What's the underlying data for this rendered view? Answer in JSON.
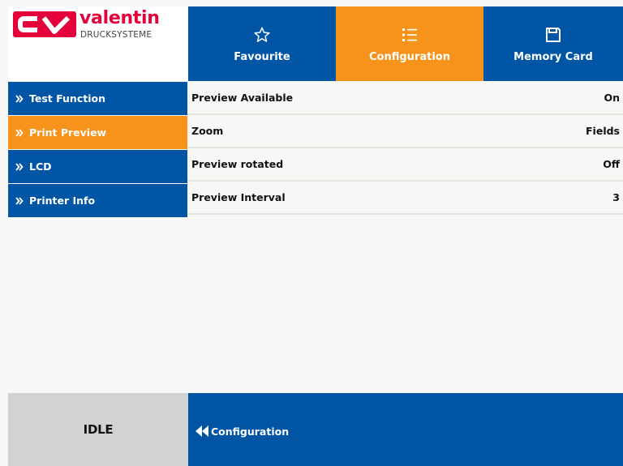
{
  "brand": {
    "logo_letters": "CV",
    "name": "valentin",
    "subtitle": "DRUCKSYSTEME",
    "color": "#e4003a"
  },
  "colors": {
    "primary": "#0055a5",
    "accent": "#f7931a",
    "status_bg": "#d2d2d2"
  },
  "tabs": [
    {
      "label": "Favourite",
      "icon": "star-icon",
      "active": false
    },
    {
      "label": "Configuration",
      "icon": "list-icon",
      "active": true
    },
    {
      "label": "Memory Card",
      "icon": "floppy-disk-icon",
      "active": false
    }
  ],
  "menu": {
    "icon": "double-chevron-right-icon",
    "items": [
      {
        "label": "Test Function",
        "active": false
      },
      {
        "label": "Print Preview",
        "active": true
      },
      {
        "label": "LCD",
        "active": false
      },
      {
        "label": "Printer Info",
        "active": false
      }
    ]
  },
  "settings": [
    {
      "label": "Preview Available",
      "value": "On"
    },
    {
      "label": "Zoom",
      "value": "Fields"
    },
    {
      "label": "Preview rotated",
      "value": "Off"
    },
    {
      "label": "Preview Interval",
      "value": "3"
    }
  ],
  "status": {
    "text": "IDLE"
  },
  "footer": {
    "back_label": "Configuration",
    "back_icon": "double-chevron-left-icon"
  }
}
